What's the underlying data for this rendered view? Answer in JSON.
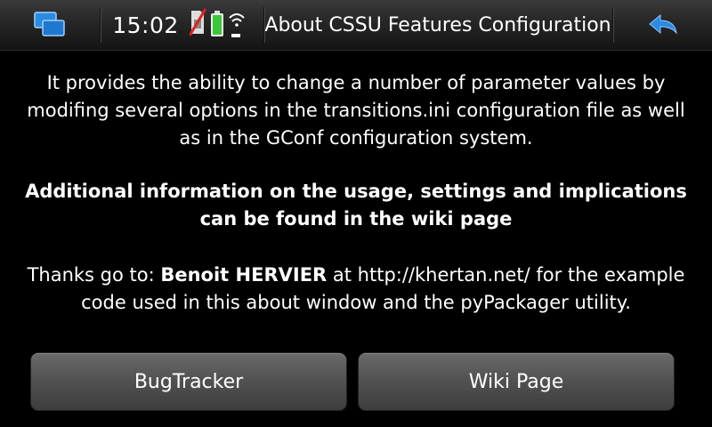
{
  "statusbar": {
    "time": "15:02",
    "title": "About CSSU Features Configuration"
  },
  "icons": {
    "task_switcher": "task-switcher-icon",
    "sim": "sim-card-icon",
    "battery": "battery-icon",
    "wifi": "wifi-signal-icon",
    "back": "back-arrow-icon"
  },
  "colors": {
    "accent": "#2a8be0",
    "battery": "#3ac83a",
    "sim_cross": "#e02020"
  },
  "content": {
    "para1": "It provides the ability to change a number of parameter values by modifing several options in the transitions.ini configuration file as well as in the GConf configuration system.",
    "para2": "Additional information on the usage, settings and implications can be found in the wiki page",
    "thanks_prefix": "Thanks go to: ",
    "thanks_name": "Benoit HERVIER",
    "thanks_suffix": " at http://khertan.net/ for the example code used in this about window and the pyPackager utility."
  },
  "buttons": {
    "bugtracker": "BugTracker",
    "wiki": "Wiki Page"
  }
}
